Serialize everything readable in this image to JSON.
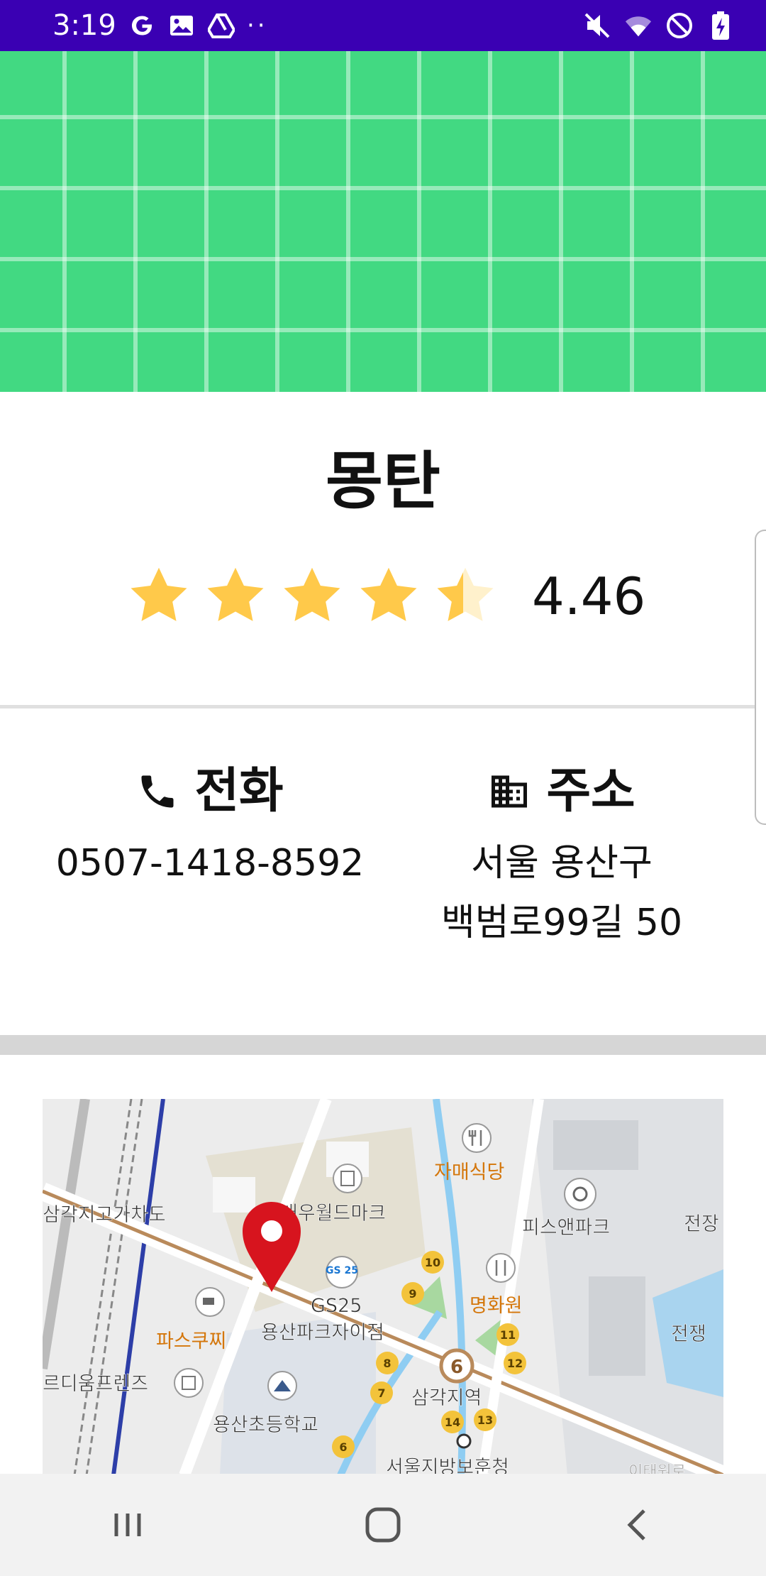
{
  "status_bar": {
    "time": "3:19",
    "left_icons": [
      "google-icon",
      "image-icon",
      "drive-icon"
    ],
    "more": "··",
    "right_icons": [
      "mute-icon",
      "wifi-icon",
      "do-not-disturb-icon",
      "battery-charging-icon"
    ]
  },
  "restaurant": {
    "name": "몽탄",
    "rating": "4.46",
    "rating_value": 4.46,
    "rating_max": 5
  },
  "info": {
    "phone": {
      "label": "전화",
      "value": "0507-1418-8592",
      "icon": "phone-icon"
    },
    "address": {
      "label": "주소",
      "line1": "서울 용산구",
      "line2": "백범로99길 50",
      "icon": "building-icon"
    }
  },
  "map": {
    "labels": {
      "jamae": "자매식당",
      "daewoo": "대우월드마크",
      "samgak_overpass": "삼각지고가차도",
      "peace_park": "피스앤파크",
      "jeonjang1": "전장",
      "gs25": "GS25",
      "yongsan_park": "용산파크자이점",
      "paris": "파스쿠찌",
      "myeonghwawon": "명화원",
      "jeonjaeng2": "전쟁",
      "deum": "르디움프렌즈",
      "samgakji": "삼각지역",
      "school": "용산초등학교",
      "court": "서울지방보훈청",
      "itaewon": "이태원로",
      "gs_badge": "GS 25"
    },
    "exits": [
      "10",
      "9",
      "11",
      "12",
      "8",
      "7",
      "14",
      "13",
      "6"
    ],
    "station_line": "6"
  },
  "colors": {
    "status_bar": "#3a00b3",
    "hero": "#42d982",
    "star": "#ffc94a",
    "star_empty": "#fff1cc",
    "marker": "#d7141e"
  },
  "nav": {
    "recents": "recents-icon",
    "home": "home-icon",
    "back": "back-icon"
  }
}
